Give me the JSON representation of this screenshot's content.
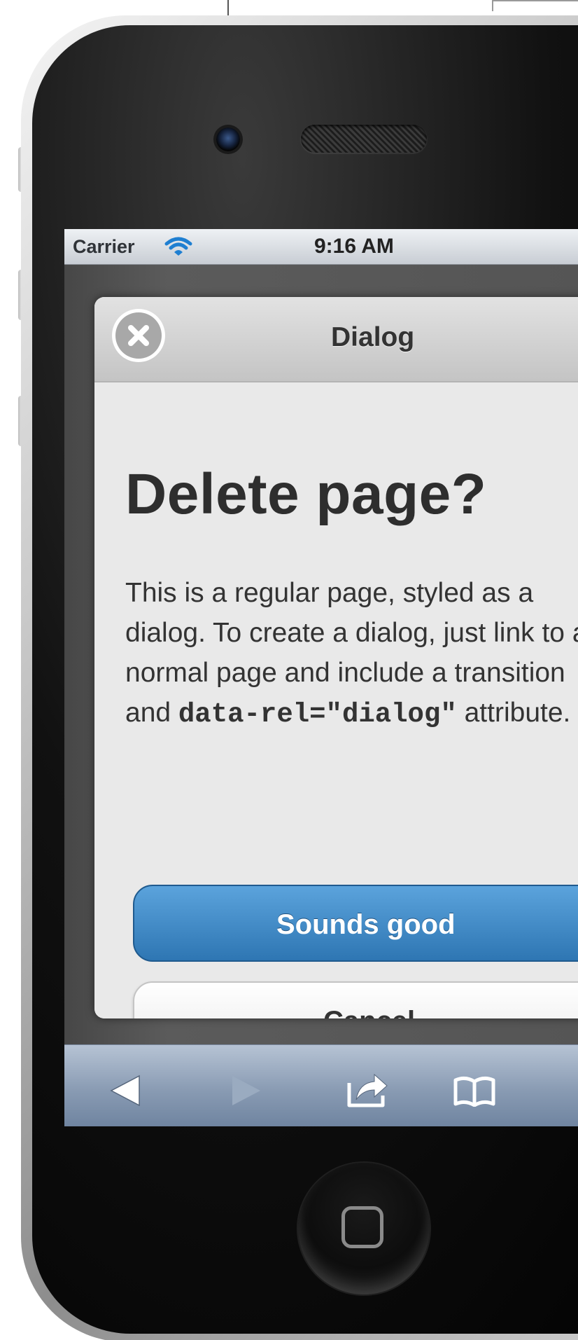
{
  "status_bar": {
    "carrier": "Carrier",
    "time": "9:16 AM"
  },
  "dialog": {
    "title": "Dialog",
    "heading": "Delete page?",
    "body_before_code": "This is a regular page, styled as a dialog. To create a dialog, just link to a normal page and include a transition and ",
    "body_code": "data-rel=\"dialog\"",
    "body_after_code": " attribute.",
    "primary_button": "Sounds good",
    "secondary_button": "Cancel"
  },
  "icons": {
    "close": "close-circle-icon",
    "wifi": "wifi-icon",
    "back": "back-arrow-icon",
    "forward": "forward-arrow-icon",
    "share": "share-icon",
    "bookmarks": "bookmarks-book-icon",
    "home": "home-button-square-icon"
  },
  "colors": {
    "primary_button": "#2e76b3",
    "toolbar": "#899bb3",
    "dialog_background": "#e9e9e9"
  }
}
